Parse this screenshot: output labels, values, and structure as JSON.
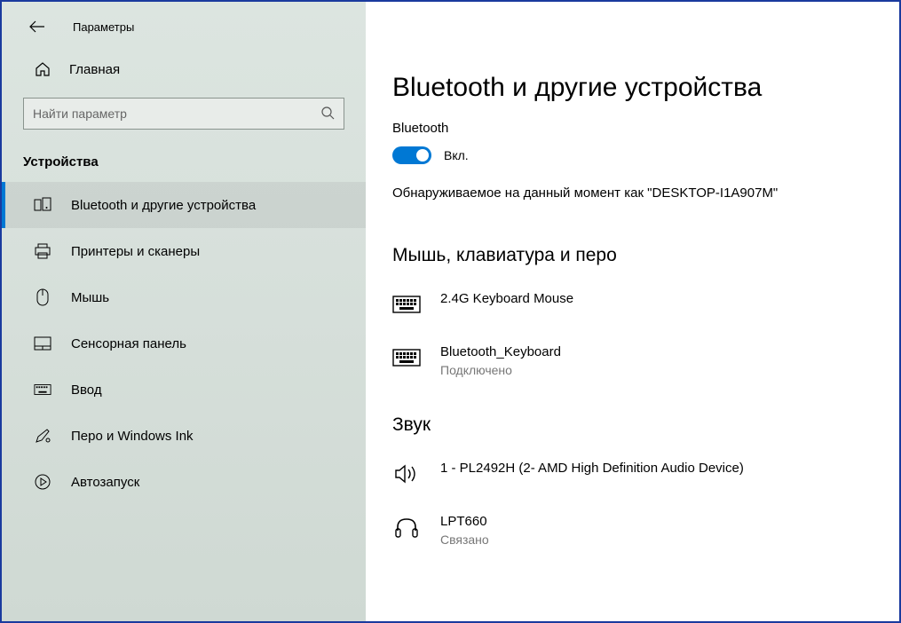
{
  "header": {
    "app_title": "Параметры"
  },
  "sidebar": {
    "home_label": "Главная",
    "search_placeholder": "Найти параметр",
    "section_label": "Устройства",
    "items": [
      {
        "label": "Bluetooth и другие устройства",
        "icon": "devices",
        "active": true
      },
      {
        "label": "Принтеры и сканеры",
        "icon": "printer",
        "active": false
      },
      {
        "label": "Мышь",
        "icon": "mouse",
        "active": false
      },
      {
        "label": "Сенсорная панель",
        "icon": "touchpad",
        "active": false
      },
      {
        "label": "Ввод",
        "icon": "keyboard",
        "active": false
      },
      {
        "label": "Перо и Windows Ink",
        "icon": "pen",
        "active": false
      },
      {
        "label": "Автозапуск",
        "icon": "autoplay",
        "active": false
      }
    ]
  },
  "main": {
    "page_title": "Bluetooth и другие устройства",
    "bluetooth_label": "Bluetooth",
    "toggle_state": "Вкл.",
    "discoverable_text": "Обнаруживаемое на данный момент как \"DESKTOP-I1A907M\"",
    "section_input": "Мышь, клавиатура и перо",
    "devices_input": [
      {
        "name": "2.4G Keyboard Mouse",
        "status": "",
        "icon": "keyboard"
      },
      {
        "name": "Bluetooth_Keyboard",
        "status": "Подключено",
        "icon": "keyboard"
      }
    ],
    "section_audio": "Звук",
    "devices_audio": [
      {
        "name": "1 - PL2492H (2- AMD High Definition Audio Device)",
        "status": "",
        "icon": "speaker"
      },
      {
        "name": "LPT660",
        "status": "Связано",
        "icon": "headphones"
      }
    ]
  }
}
